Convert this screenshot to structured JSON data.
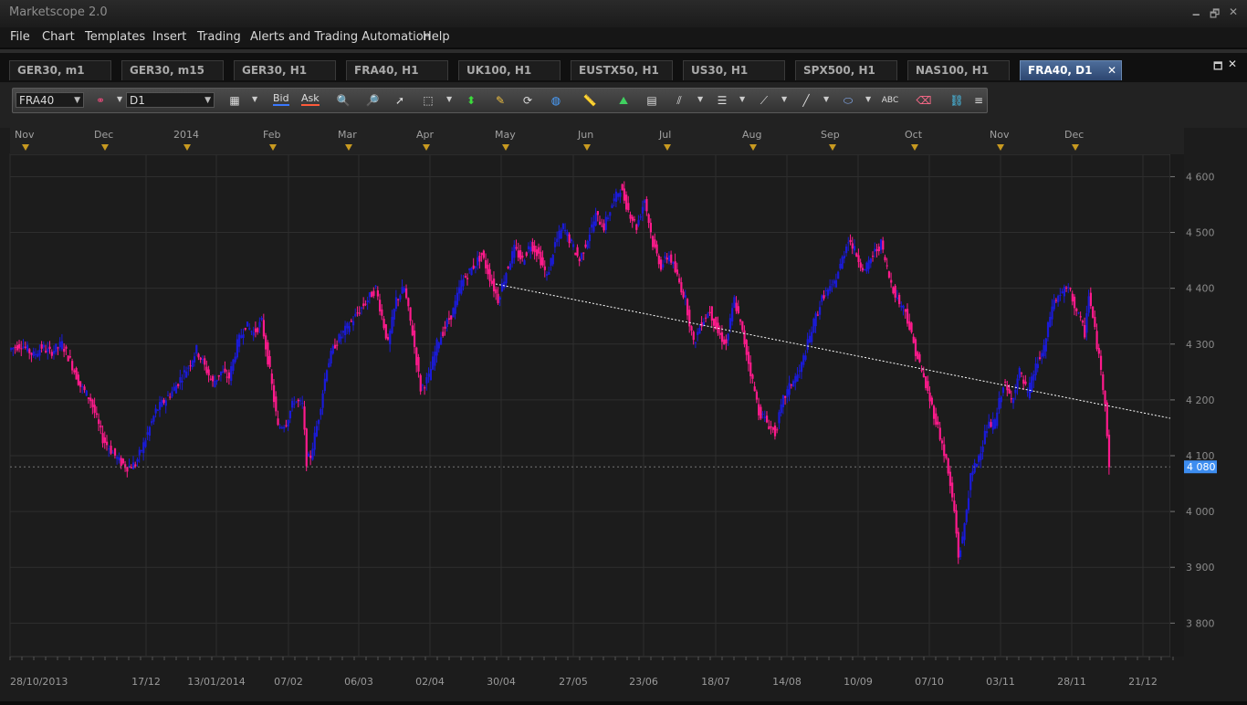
{
  "window": {
    "title": "Marketscope 2.0",
    "minimize": "🗕",
    "restore": "🗗",
    "close": "✕"
  },
  "menu": [
    "File",
    "Chart",
    "Templates",
    "Insert",
    "Trading",
    "Alerts and Trading Automation",
    "Help"
  ],
  "tabs": [
    {
      "label": "GER30, m1"
    },
    {
      "label": "GER30, m15"
    },
    {
      "label": "GER30, H1"
    },
    {
      "label": "FRA40, H1"
    },
    {
      "label": "UK100, H1"
    },
    {
      "label": "EUSTX50, H1"
    },
    {
      "label": "US30, H1"
    },
    {
      "label": "SPX500, H1"
    },
    {
      "label": "NAS100, H1"
    },
    {
      "label": "FRA40, D1",
      "active": true
    }
  ],
  "toolbar": {
    "symbol": "FRA40",
    "timeframe": "D1",
    "bid_label": "Bid",
    "ask_label": "Ask",
    "icons": [
      "chart-type-icon",
      "bid-icon",
      "ask-icon",
      "zoom-in-icon",
      "zoom-out-icon",
      "cursor-icon",
      "zoom-rect-icon",
      "crosshair-icon",
      "note-icon",
      "link-icon",
      "globe-icon",
      "ruler-icon",
      "indicator-icon",
      "properties-icon",
      "parallel-channel-icon",
      "levels-icon",
      "fan-icon",
      "line-icon",
      "ellipse-icon",
      "text-icon",
      "eraser-icon",
      "network-icon",
      "more-icon"
    ]
  },
  "chart_data": {
    "type": "candlestick",
    "symbol": "FRA40",
    "timeframe": "D1",
    "current_price": "4 080",
    "ylim": [
      3740,
      4640
    ],
    "y_ticks": [
      "4 600",
      "4 500",
      "4 400",
      "4 300",
      "4 200",
      "4 100",
      "4 000",
      "3 900",
      "3 800"
    ],
    "y_tick_values": [
      4600,
      4500,
      4400,
      4300,
      4200,
      4100,
      4000,
      3900,
      3800
    ],
    "top_month_labels": [
      "Nov",
      "Dec",
      "2014",
      "Feb",
      "Mar",
      "Apr",
      "May",
      "Jun",
      "Jul",
      "Aug",
      "Sep",
      "Oct",
      "Nov",
      "Dec"
    ],
    "bottom_date_labels": [
      "28/10/2013",
      "17/12",
      "13/01/2014",
      "07/02",
      "06/03",
      "02/04",
      "30/04",
      "27/05",
      "23/06",
      "18/07",
      "14/08",
      "10/09",
      "07/10",
      "03/11",
      "28/11",
      "21/12"
    ],
    "bull_color": "#1a1ad8",
    "bear_color": "#ff1a8c",
    "trendline_color": "#ffffff",
    "close_path": [
      [
        0,
        4290
      ],
      [
        6,
        4300
      ],
      [
        12,
        4280
      ],
      [
        16,
        4295
      ],
      [
        20,
        4285
      ],
      [
        26,
        4300
      ],
      [
        30,
        4270
      ],
      [
        35,
        4225
      ],
      [
        40,
        4200
      ],
      [
        46,
        4130
      ],
      [
        50,
        4110
      ],
      [
        54,
        4090
      ],
      [
        58,
        4080
      ],
      [
        62,
        4085
      ],
      [
        66,
        4120
      ],
      [
        72,
        4180
      ],
      [
        80,
        4215
      ],
      [
        88,
        4260
      ],
      [
        92,
        4290
      ],
      [
        96,
        4260
      ],
      [
        100,
        4230
      ],
      [
        104,
        4250
      ],
      [
        108,
        4240
      ],
      [
        112,
        4300
      ],
      [
        116,
        4335
      ],
      [
        120,
        4320
      ],
      [
        124,
        4340
      ],
      [
        128,
        4250
      ],
      [
        132,
        4150
      ],
      [
        136,
        4160
      ],
      [
        140,
        4200
      ],
      [
        144,
        4190
      ],
      [
        146,
        4090
      ],
      [
        148,
        4100
      ],
      [
        152,
        4170
      ],
      [
        156,
        4260
      ],
      [
        160,
        4300
      ],
      [
        166,
        4330
      ],
      [
        172,
        4360
      ],
      [
        176,
        4380
      ],
      [
        180,
        4400
      ],
      [
        183,
        4350
      ],
      [
        186,
        4300
      ],
      [
        190,
        4380
      ],
      [
        194,
        4400
      ],
      [
        198,
        4320
      ],
      [
        202,
        4220
      ],
      [
        206,
        4240
      ],
      [
        210,
        4300
      ],
      [
        214,
        4330
      ],
      [
        218,
        4360
      ],
      [
        222,
        4410
      ],
      [
        228,
        4440
      ],
      [
        232,
        4460
      ],
      [
        236,
        4420
      ],
      [
        240,
        4380
      ],
      [
        244,
        4430
      ],
      [
        248,
        4470
      ],
      [
        252,
        4450
      ],
      [
        256,
        4480
      ],
      [
        260,
        4460
      ],
      [
        264,
        4420
      ],
      [
        268,
        4480
      ],
      [
        272,
        4510
      ],
      [
        276,
        4480
      ],
      [
        280,
        4450
      ],
      [
        284,
        4490
      ],
      [
        288,
        4530
      ],
      [
        292,
        4510
      ],
      [
        296,
        4550
      ],
      [
        300,
        4580
      ],
      [
        304,
        4540
      ],
      [
        308,
        4510
      ],
      [
        312,
        4560
      ],
      [
        316,
        4480
      ],
      [
        320,
        4440
      ],
      [
        324,
        4460
      ],
      [
        328,
        4420
      ],
      [
        332,
        4380
      ],
      [
        336,
        4300
      ],
      [
        340,
        4340
      ],
      [
        344,
        4360
      ],
      [
        348,
        4320
      ],
      [
        352,
        4300
      ],
      [
        356,
        4380
      ],
      [
        360,
        4320
      ],
      [
        364,
        4250
      ],
      [
        368,
        4180
      ],
      [
        372,
        4160
      ],
      [
        376,
        4140
      ],
      [
        380,
        4200
      ],
      [
        384,
        4230
      ],
      [
        388,
        4250
      ],
      [
        392,
        4300
      ],
      [
        396,
        4350
      ],
      [
        400,
        4390
      ],
      [
        404,
        4400
      ],
      [
        408,
        4440
      ],
      [
        412,
        4490
      ],
      [
        416,
        4460
      ],
      [
        420,
        4430
      ],
      [
        424,
        4460
      ],
      [
        428,
        4480
      ],
      [
        432,
        4420
      ],
      [
        436,
        4380
      ],
      [
        440,
        4360
      ],
      [
        444,
        4300
      ],
      [
        448,
        4250
      ],
      [
        452,
        4200
      ],
      [
        456,
        4150
      ],
      [
        460,
        4090
      ],
      [
        464,
        4000
      ],
      [
        466,
        3920
      ],
      [
        468,
        3950
      ],
      [
        472,
        4060
      ],
      [
        476,
        4100
      ],
      [
        480,
        4150
      ],
      [
        484,
        4160
      ],
      [
        488,
        4230
      ],
      [
        492,
        4200
      ],
      [
        496,
        4250
      ],
      [
        500,
        4210
      ],
      [
        504,
        4260
      ],
      [
        508,
        4290
      ],
      [
        512,
        4370
      ],
      [
        516,
        4390
      ],
      [
        520,
        4400
      ],
      [
        524,
        4360
      ],
      [
        528,
        4320
      ],
      [
        530,
        4390
      ],
      [
        534,
        4300
      ],
      [
        538,
        4200
      ],
      [
        540,
        4080
      ]
    ],
    "trendline": [
      [
        543,
        171
      ],
      [
        1282,
        318
      ]
    ],
    "price_marker_y": 4080
  }
}
